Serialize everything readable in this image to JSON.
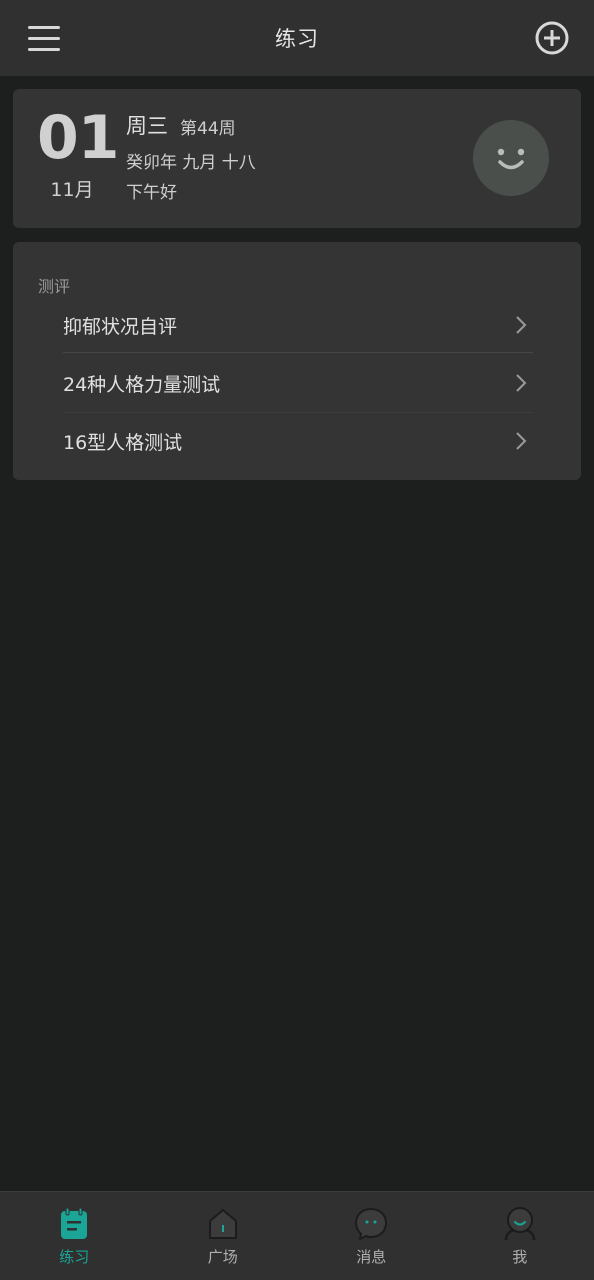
{
  "header": {
    "title": "练习",
    "menu_icon": "hamburger-menu-icon",
    "add_icon": "plus-circle-icon"
  },
  "date_card": {
    "day": "01",
    "month": "11月",
    "weekday": "周三",
    "week_number": "第44周",
    "lunar_date": "癸卯年 九月 十八",
    "greeting": "下午好",
    "mood_icon": "smiley-face-icon"
  },
  "assessment": {
    "section_label": "测评",
    "items": [
      {
        "label": "抑郁状况自评"
      },
      {
        "label": "24种人格力量测试"
      },
      {
        "label": "16型人格测试"
      }
    ]
  },
  "bottom_nav": {
    "items": [
      {
        "label": "练习",
        "icon": "notebook-icon",
        "active": true
      },
      {
        "label": "广场",
        "icon": "home-icon",
        "active": false
      },
      {
        "label": "消息",
        "icon": "chat-bubble-icon",
        "active": false
      },
      {
        "label": "我",
        "icon": "profile-icon",
        "active": false
      }
    ]
  },
  "colors": {
    "accent": "#1aa597",
    "background": "#1d1e1e",
    "card": "#333433",
    "bar": "#2f302f"
  }
}
